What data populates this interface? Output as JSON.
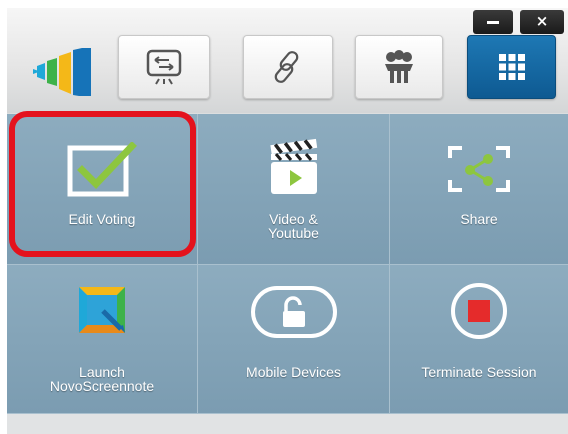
{
  "window": {
    "minimize_label": "–",
    "close_label": "×"
  },
  "toolbar": {
    "logo_icon": "novo-logo-icon",
    "buttons": [
      {
        "icon": "screen-projection-icon",
        "active": false
      },
      {
        "icon": "link-icon",
        "active": false
      },
      {
        "icon": "group-icon",
        "active": false
      },
      {
        "icon": "apps-grid-icon",
        "active": true
      }
    ],
    "active_color": "#1467a5"
  },
  "tiles": [
    {
      "label": "Edit Voting",
      "icon": "checkbox-icon"
    },
    {
      "label": "Video &\nYoutube",
      "icon": "video-clapper-icon"
    },
    {
      "label": "Share",
      "icon": "share-icon"
    },
    {
      "label": "Launch\nNovoScreennote",
      "icon": "screennote-icon"
    },
    {
      "label": "Mobile Devices",
      "icon": "unlock-icon"
    },
    {
      "label": "Terminate Session",
      "icon": "stop-icon"
    }
  ],
  "highlight": {
    "target": "Edit Voting",
    "color": "#e4121d"
  }
}
